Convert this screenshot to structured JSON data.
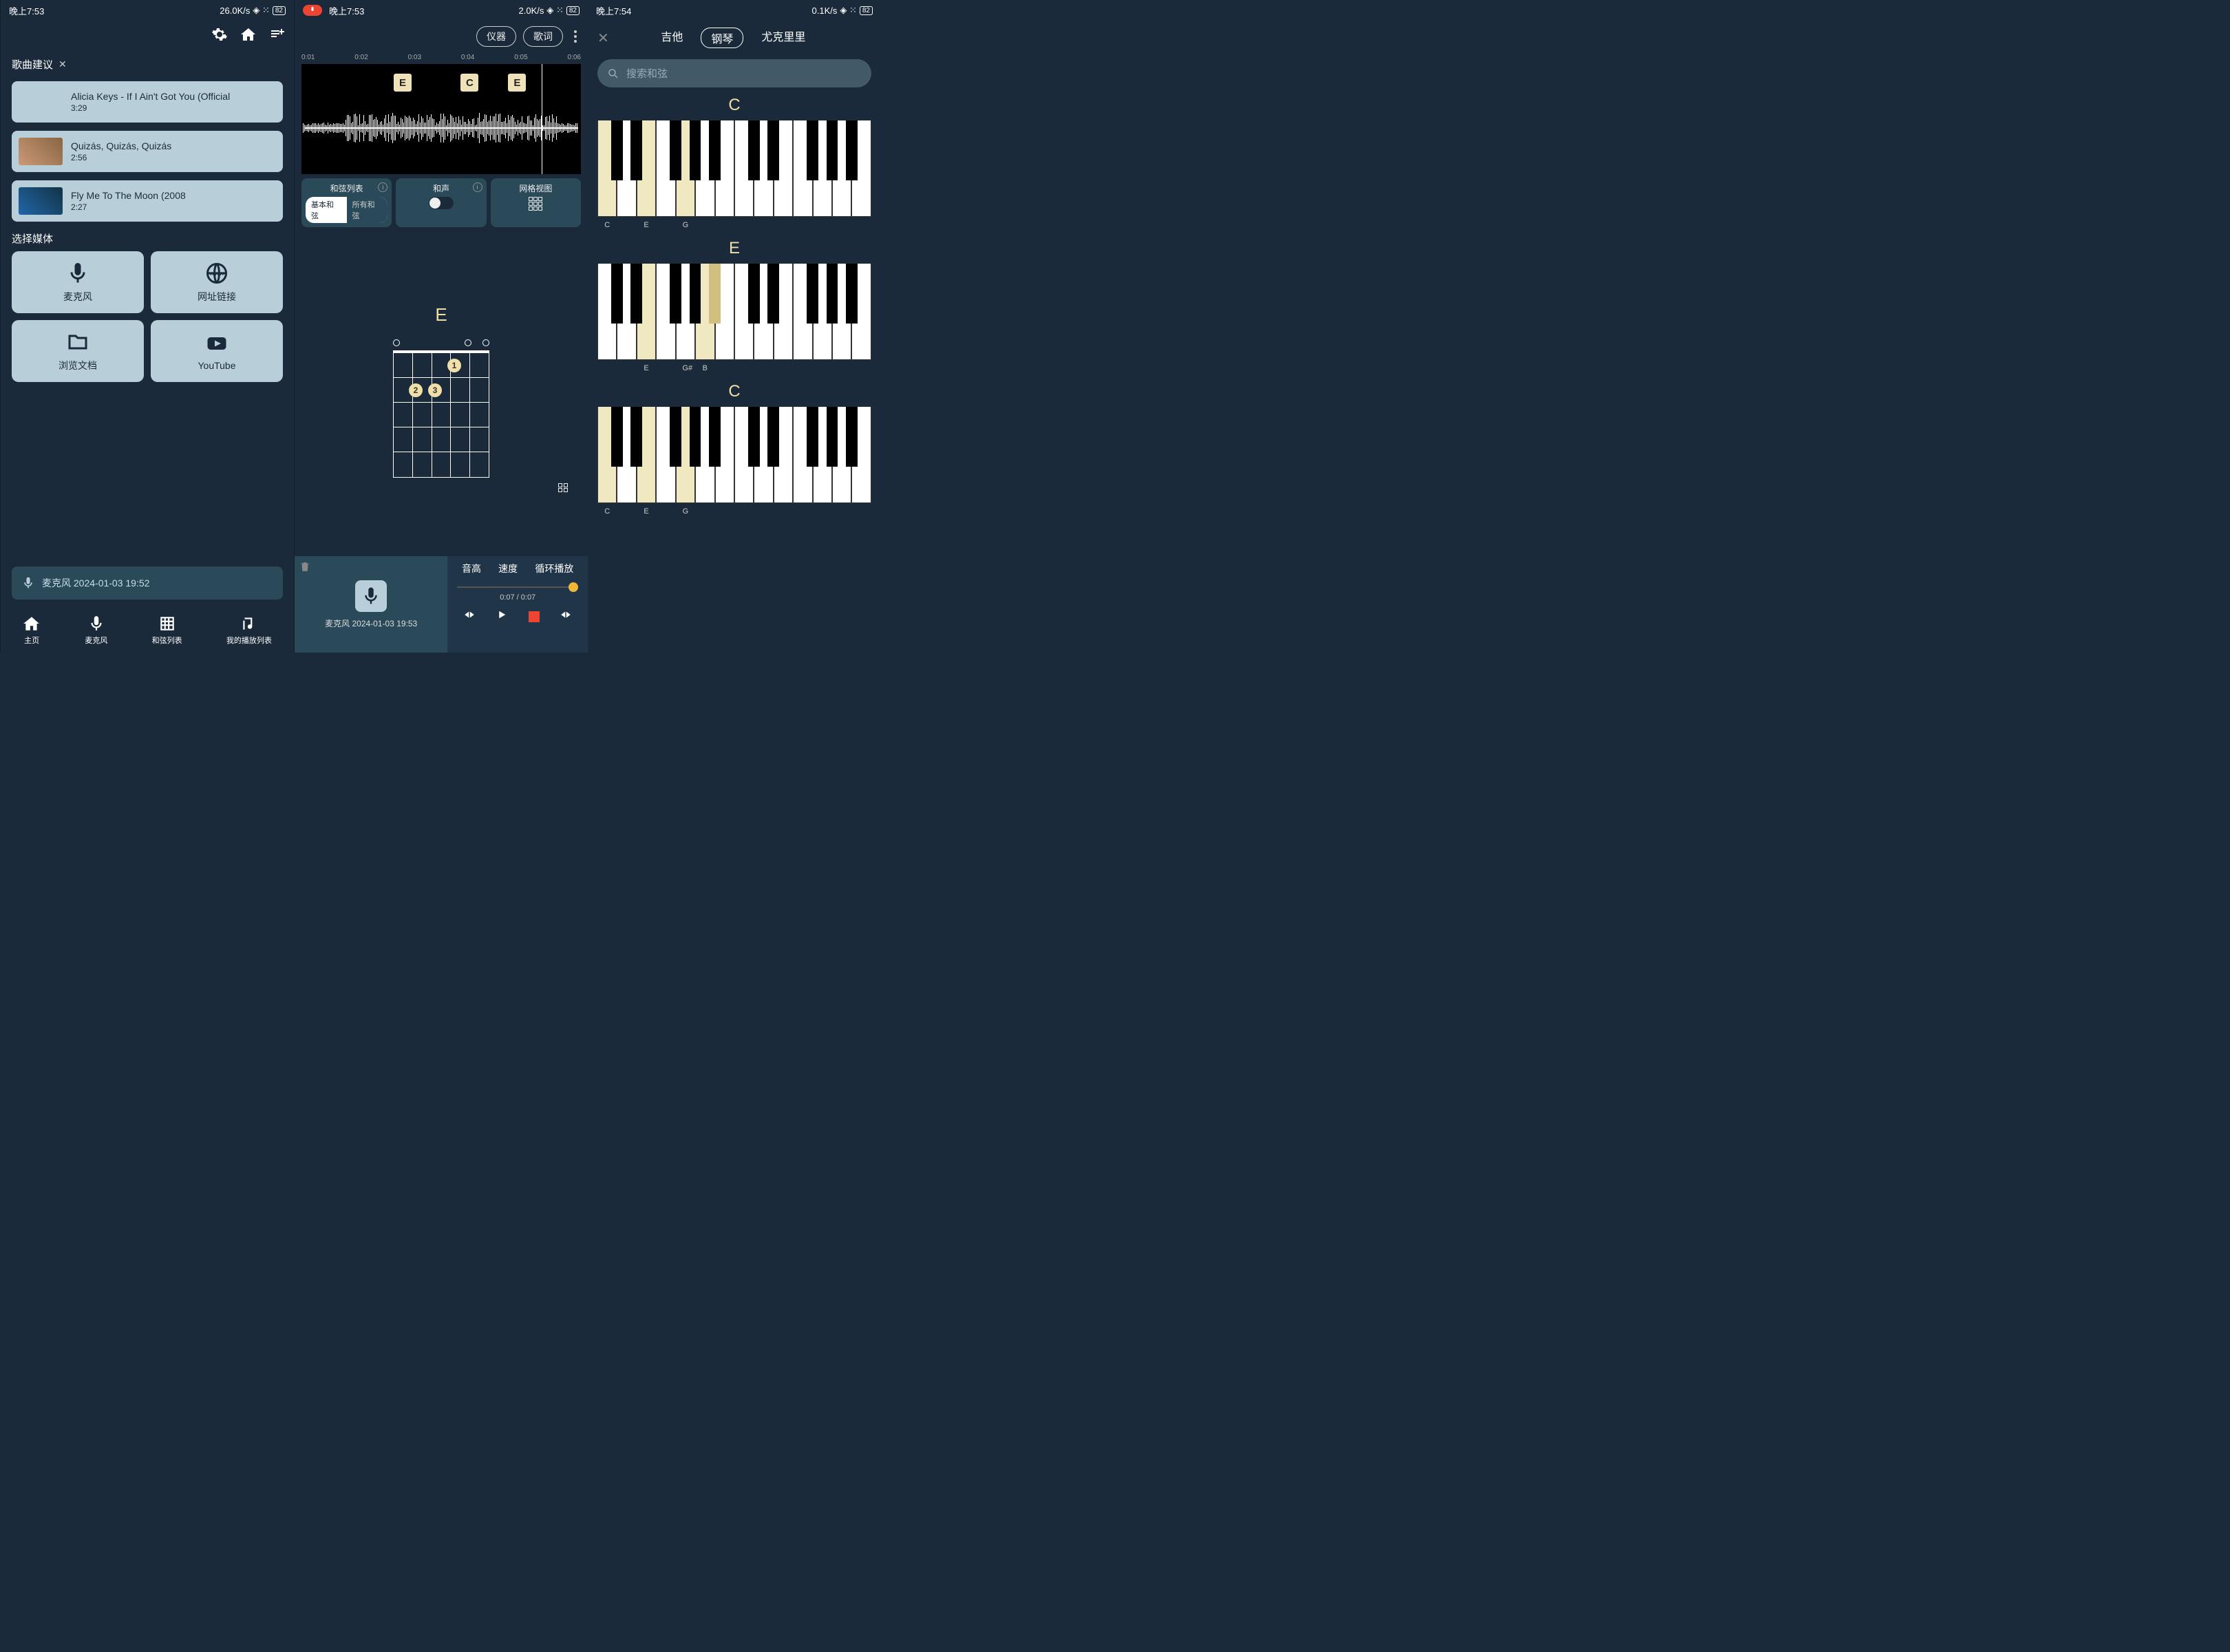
{
  "screen1": {
    "status": {
      "time": "晚上7:53",
      "speed": "26.0K/s",
      "batt": "82"
    },
    "suggestions_title": "歌曲建议",
    "songs": [
      {
        "title": "Alicia Keys - If I Ain't Got You (Official",
        "duration": "3:29"
      },
      {
        "title": "Quizás, Quizás, Quizás",
        "duration": "2:56"
      },
      {
        "title": "Fly Me To The Moon (2008",
        "duration": "2:27"
      }
    ],
    "select_media": "选择媒体",
    "media": {
      "mic": "麦克风",
      "url": "网址链接",
      "browse": "浏览文档",
      "youtube": "YouTube"
    },
    "recent": "麦克风 2024-01-03 19:52",
    "nav": {
      "home": "主页",
      "mic": "麦克风",
      "chords": "和弦列表",
      "playlist": "我的播放列表"
    }
  },
  "screen2": {
    "status": {
      "time": "晚上7:53",
      "speed": "2.0K/s",
      "batt": "82"
    },
    "header": {
      "instrument": "仪器",
      "lyrics": "歌词"
    },
    "ticks": [
      "0:01",
      "0:02",
      "0:03",
      "0:04",
      "0:05",
      "0:06"
    ],
    "chords": [
      {
        "c": "E",
        "x": 33
      },
      {
        "c": "C",
        "x": 57
      },
      {
        "c": "E",
        "x": 74
      }
    ],
    "controls": {
      "list": "和弦列表",
      "basic": "基本和弦",
      "all": "所有和弦",
      "harmony": "和声",
      "grid": "网格视图"
    },
    "big_chord": "E",
    "player": {
      "title": "麦克风 2024-01-03 19:53",
      "pitch": "音高",
      "speed": "速度",
      "loop": "循环播放",
      "time": "0:07 / 0:07"
    }
  },
  "screen3": {
    "status": {
      "time": "晚上7:54",
      "speed": "0.1K/s",
      "batt": "82"
    },
    "tabs": {
      "guitar": "吉他",
      "piano": "钢琴",
      "uke": "尤克里里"
    },
    "search": "搜索和弦",
    "chords": [
      {
        "name": "C",
        "hl": [
          0,
          2,
          4
        ],
        "labels": [
          "C",
          "E",
          "G"
        ]
      },
      {
        "name": "E",
        "hl": [
          2,
          5
        ],
        "labels": [
          "E",
          "G#",
          "B"
        ],
        "blackhl": [
          4
        ]
      },
      {
        "name": "C",
        "hl": [
          0,
          2,
          4
        ],
        "labels": [
          "C",
          "E",
          "G"
        ]
      }
    ]
  }
}
